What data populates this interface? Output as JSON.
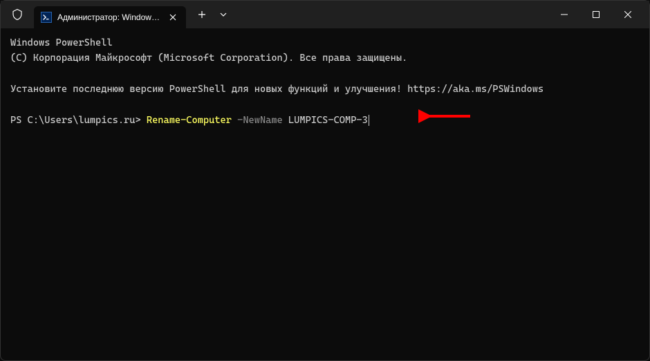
{
  "titlebar": {
    "tab_title": "Администратор: Windows Pc"
  },
  "terminal": {
    "line1": "Windows PowerShell",
    "line2": "(C) Корпорация Майкрософт (Microsoft Corporation). Все права защищены.",
    "line3": "Установите последнюю версию PowerShell для новых функций и улучшения! https://aka.ms/PSWindows",
    "prompt": "PS C:\\Users\\lumpics.ru> ",
    "cmdlet": "Rename-Computer",
    "param": " -NewName ",
    "arg": "LUMPICS-COMP-3"
  }
}
